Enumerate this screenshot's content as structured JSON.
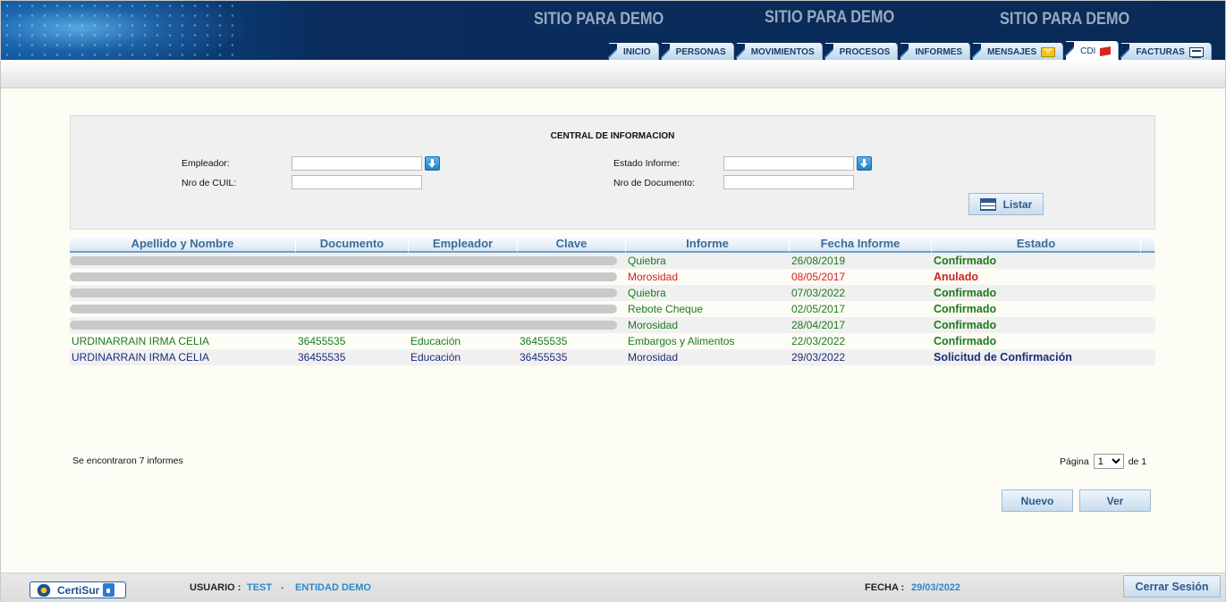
{
  "header": {
    "banner_texts": [
      "SITIO PARA DEMO",
      "SITIO PARA DEMO",
      "SITIO PARA DEMO"
    ],
    "tabs": [
      {
        "label": "INICIO",
        "active": false
      },
      {
        "label": "PERSONAS",
        "active": false
      },
      {
        "label": "MOVIMIENTOS",
        "active": false
      },
      {
        "label": "PROCESOS",
        "active": false
      },
      {
        "label": "INFORMES",
        "active": false
      },
      {
        "label": "MENSAJES",
        "active": false,
        "icon": "envelope-icon"
      },
      {
        "label": "CDI",
        "active": true,
        "icon": "flag-icon"
      },
      {
        "label": "FACTURAS",
        "active": false,
        "icon": "invoice-icon"
      }
    ]
  },
  "filters": {
    "title": "CENTRAL DE INFORMACION",
    "empleador_label": "Empleador:",
    "empleador_value": "",
    "cuil_label": "Nro de CUIL:",
    "cuil_value": "",
    "estado_label": "Estado Informe:",
    "estado_value": "",
    "documento_label": "Nro de Documento:",
    "documento_value": "",
    "listar_label": "Listar"
  },
  "table": {
    "headers": [
      "Apellido y Nombre",
      "Documento",
      "Empleador",
      "Clave",
      "Informe",
      "Fecha Informe",
      "Estado"
    ],
    "rows": [
      {
        "nombre": "",
        "documento": "",
        "empleador": "",
        "clave": "",
        "informe": "Quiebra",
        "fecha": "26/08/2019",
        "estado": "Confirmado",
        "color": "green",
        "estado_color": "green",
        "redacted": true
      },
      {
        "nombre": "",
        "documento": "",
        "empleador": "",
        "clave": "",
        "informe": "Morosidad",
        "fecha": "08/05/2017",
        "estado": "Anulado",
        "color": "red",
        "estado_color": "red",
        "redacted": true
      },
      {
        "nombre": "",
        "documento": "",
        "empleador": "",
        "clave": "",
        "informe": "Quiebra",
        "fecha": "07/03/2022",
        "estado": "Confirmado",
        "color": "green",
        "estado_color": "green",
        "redacted": true
      },
      {
        "nombre": "",
        "documento": "",
        "empleador": "",
        "clave": "",
        "informe": "Rebote Cheque",
        "fecha": "02/05/2017",
        "estado": "Confirmado",
        "color": "green",
        "estado_color": "green",
        "redacted": true
      },
      {
        "nombre": "",
        "documento": "",
        "empleador": "",
        "clave": "",
        "informe": "Morosidad",
        "fecha": "28/04/2017",
        "estado": "Confirmado",
        "color": "green",
        "estado_color": "green",
        "redacted": true
      },
      {
        "nombre": "URDINARRAIN IRMA CELIA",
        "documento": "36455535",
        "empleador": "Educación",
        "clave": "36455535",
        "informe": "Embargos y Alimentos",
        "fecha": "22/03/2022",
        "estado": "Confirmado",
        "color": "green",
        "estado_color": "green",
        "redacted": false
      },
      {
        "nombre": "URDINARRAIN IRMA CELIA",
        "documento": "36455535",
        "empleador": "Educación",
        "clave": "36455535",
        "informe": "Morosidad",
        "fecha": "29/03/2022",
        "estado": "Solicitud de Confirmación",
        "color": "navy",
        "estado_color": "navy",
        "redacted": false
      }
    ]
  },
  "summary": {
    "count_text": "Se encontraron 7 informes",
    "page_label": "Página",
    "page_value": "1",
    "page_of": "de 1"
  },
  "actions": {
    "nuevo_label": "Nuevo",
    "ver_label": "Ver"
  },
  "footer": {
    "logo_text": "CertiSur",
    "usuario_label": "USUARIO :",
    "usuario_value": "TEST",
    "separator": "-",
    "entidad_value": "ENTIDAD DEMO",
    "fecha_label": "FECHA :",
    "fecha_value": "29/03/2022",
    "logout_label": "Cerrar Sesión"
  },
  "colors": {
    "header_bg": "#0a2a56",
    "tab_text": "#1b3c6a",
    "table_header_text": "#3b6c9c",
    "green": "#1e7a1e",
    "red": "#d21f1f",
    "navy": "#1d2c7a",
    "footer_value": "#2a8ac9"
  }
}
